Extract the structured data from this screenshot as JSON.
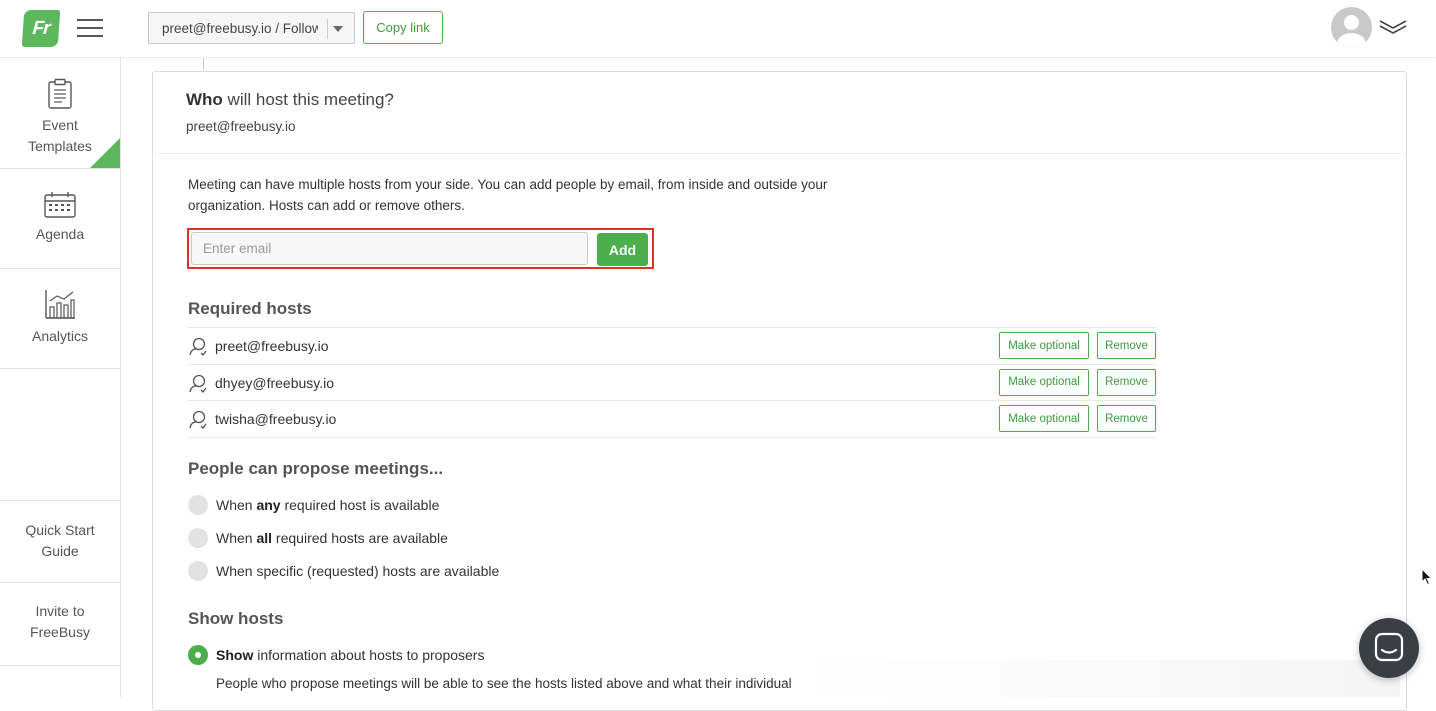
{
  "header": {
    "logo_text": "Fr",
    "account_selector": "preet@freebusy.io / Follow",
    "copy_link_label": "Copy link"
  },
  "sidebar": {
    "items": [
      {
        "label": "Event Templates",
        "icon": "clipboard-icon",
        "active": true
      },
      {
        "label": "Agenda",
        "icon": "calendar-icon"
      },
      {
        "label": "Analytics",
        "icon": "bar-chart-icon"
      },
      {
        "label": "Quick Start Guide"
      },
      {
        "label": "Invite to FreeBusy"
      }
    ]
  },
  "hosts_section": {
    "question_bold": "Who",
    "question_rest": " will host this meeting?",
    "current_value": "preet@freebusy.io",
    "description": "Meeting can have multiple hosts from your side. You can add people by email, from inside and outside your organization. Hosts can add or remove others.",
    "email_placeholder": "Enter email",
    "add_label": "Add",
    "required_title": "Required hosts",
    "hosts": [
      {
        "email": "preet@freebusy.io",
        "make_optional": "Make optional",
        "remove": "Remove"
      },
      {
        "email": "dhyey@freebusy.io",
        "make_optional": "Make optional",
        "remove": "Remove"
      },
      {
        "email": "twisha@freebusy.io",
        "make_optional": "Make optional",
        "remove": "Remove"
      }
    ]
  },
  "propose": {
    "title": "People can propose meetings...",
    "options": [
      {
        "pre": "When ",
        "bold": "any",
        "post": " required host is available",
        "selected": false
      },
      {
        "pre": "When ",
        "bold": "all",
        "post": " required hosts are available",
        "selected": false
      },
      {
        "pre": "When specific (requested) hosts are available",
        "bold": "",
        "post": "",
        "selected": false
      }
    ]
  },
  "show_hosts": {
    "title": "Show hosts",
    "option_bold": "Show",
    "option_rest": " information about hosts to proposers",
    "note": "People who propose meetings will be able to see the hosts listed above and what their individual"
  },
  "colors": {
    "brand_green": "#4cae4c",
    "highlight_red": "#e0302a",
    "chat_button": "#3a3f45"
  }
}
